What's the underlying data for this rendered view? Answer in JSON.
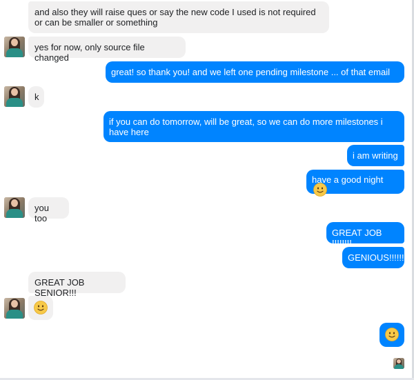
{
  "messages": [
    {
      "side": "in",
      "text": "and also they will raise ques or say the new code I used is not required or can be smaller or something"
    },
    {
      "side": "in",
      "text": "yes for now, only source file changed"
    },
    {
      "side": "out",
      "text": "great! so thank you! and we left one pending milestone ... of that email ..."
    },
    {
      "side": "in",
      "text": "k"
    },
    {
      "side": "out",
      "text": "if you can do tomorrow, will be great, so we can do more milestones i have here"
    },
    {
      "side": "out",
      "text": "i am writing"
    },
    {
      "side": "out",
      "text": "have a good night",
      "emoji": "slightly-smiling-face"
    },
    {
      "side": "in",
      "text": "you too"
    },
    {
      "side": "out",
      "text": "GREAT JOB !!!!!!!!"
    },
    {
      "side": "out",
      "text": "GENIOUS!!!!!!"
    },
    {
      "side": "in",
      "text": "GREAT JOB SENIOR!!!"
    },
    {
      "side": "in",
      "emoji": "slightly-smiling-face"
    },
    {
      "side": "out",
      "emoji": "slightly-smiling-face"
    }
  ],
  "colors": {
    "outgoing_bubble": "#0084ff",
    "incoming_bubble": "#f1f0f0",
    "emoji_face": "#f7c948"
  },
  "icons": {
    "avatar": "contact-avatar-icon",
    "emoji": "slightly-smiling-face-emoji"
  }
}
